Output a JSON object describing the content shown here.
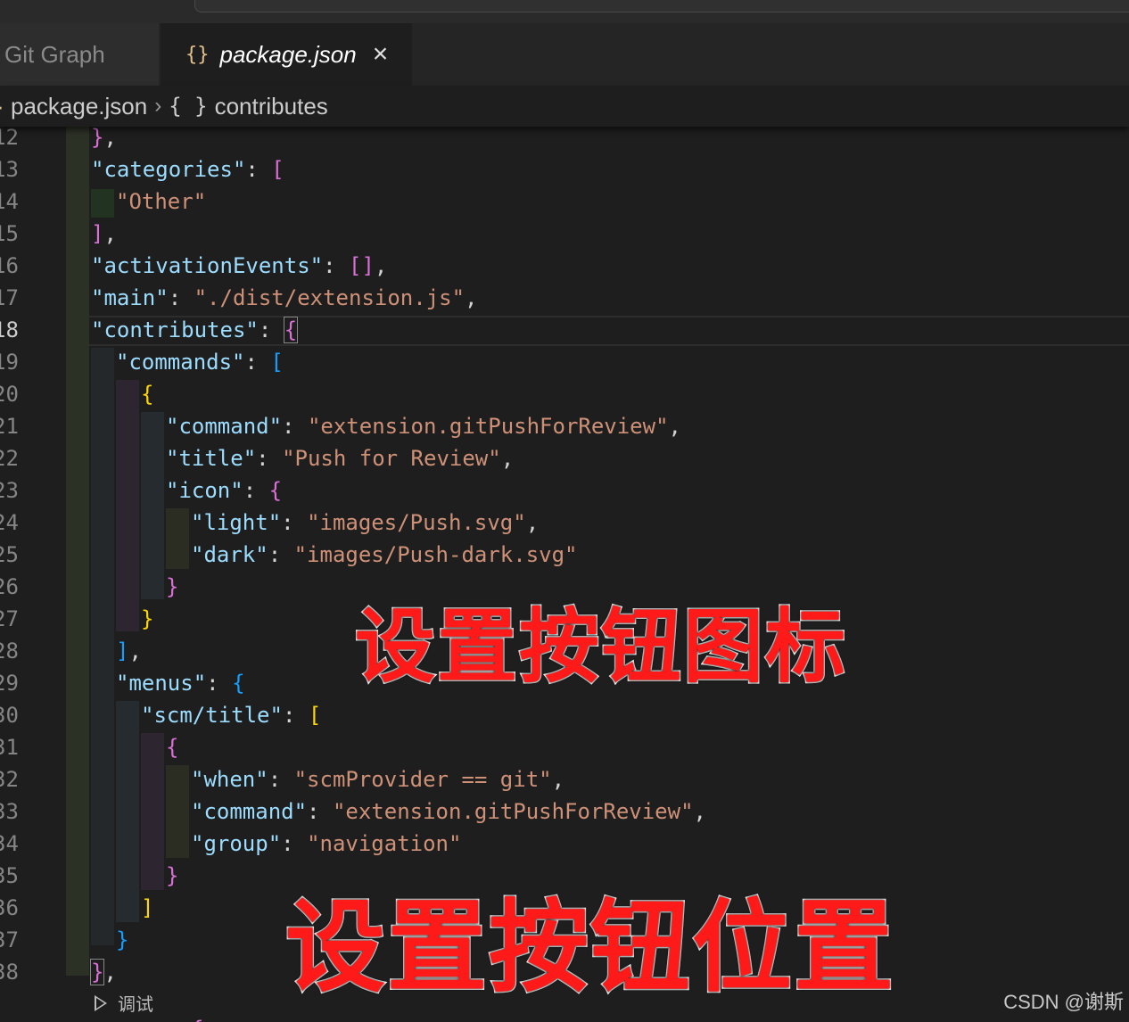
{
  "tabs": [
    {
      "label": "Git Graph",
      "active": false
    },
    {
      "label": "package.json",
      "icon": "json-braces-icon",
      "active": true,
      "close": "×"
    }
  ],
  "breadcrumb": {
    "file": "package.json",
    "separator": "›",
    "symbol": "contributes",
    "symbol_icon": "{ }"
  },
  "editor": {
    "active_line": "18",
    "lines": [
      {
        "n": "12"
      },
      {
        "n": "13"
      },
      {
        "n": "14"
      },
      {
        "n": "15"
      },
      {
        "n": "16"
      },
      {
        "n": "17"
      },
      {
        "n": "18"
      },
      {
        "n": "19"
      },
      {
        "n": "20"
      },
      {
        "n": "21"
      },
      {
        "n": "22"
      },
      {
        "n": "23"
      },
      {
        "n": "24"
      },
      {
        "n": "25"
      },
      {
        "n": "26"
      },
      {
        "n": "27"
      },
      {
        "n": "28"
      },
      {
        "n": "29"
      },
      {
        "n": "30"
      },
      {
        "n": "31"
      },
      {
        "n": "32"
      },
      {
        "n": "33"
      },
      {
        "n": "34"
      },
      {
        "n": "35"
      },
      {
        "n": "36"
      },
      {
        "n": "37"
      },
      {
        "n": "38"
      }
    ],
    "tokens": {
      "categories_key": "\"categories\"",
      "other_value": "\"Other\"",
      "activation_key": "\"activationEvents\"",
      "main_key": "\"main\"",
      "main_value": "\"./dist/extension.js\"",
      "contributes_key": "\"contributes\"",
      "commands_key": "\"commands\"",
      "command_key": "\"command\"",
      "command_value": "\"extension.gitPushForReview\"",
      "title_key": "\"title\"",
      "title_value": "\"Push for Review\"",
      "icon_key": "\"icon\"",
      "light_key": "\"light\"",
      "light_value": "\"images/Push.svg\"",
      "dark_key": "\"dark\"",
      "dark_value": "\"images/Push-dark.svg\"",
      "menus_key": "\"menus\"",
      "scm_title_key": "\"scm/title\"",
      "when_key": "\"when\"",
      "when_value": "\"scmProvider == git\"",
      "group_key": "\"group\"",
      "group_value": "\"navigation\""
    },
    "code_lens": "调试"
  },
  "overlays": {
    "icon_caption": "设置按钮图标",
    "position_caption": "设置按钮位置"
  },
  "watermark": "CSDN @谢斯",
  "colors": {
    "key": "#9cdcfe",
    "string": "#ce9178",
    "bracket_gold": "#ffd700",
    "bracket_orchid": "#da70d6",
    "bracket_blue": "#179fff",
    "overlay_red": "#ff1a1a"
  }
}
